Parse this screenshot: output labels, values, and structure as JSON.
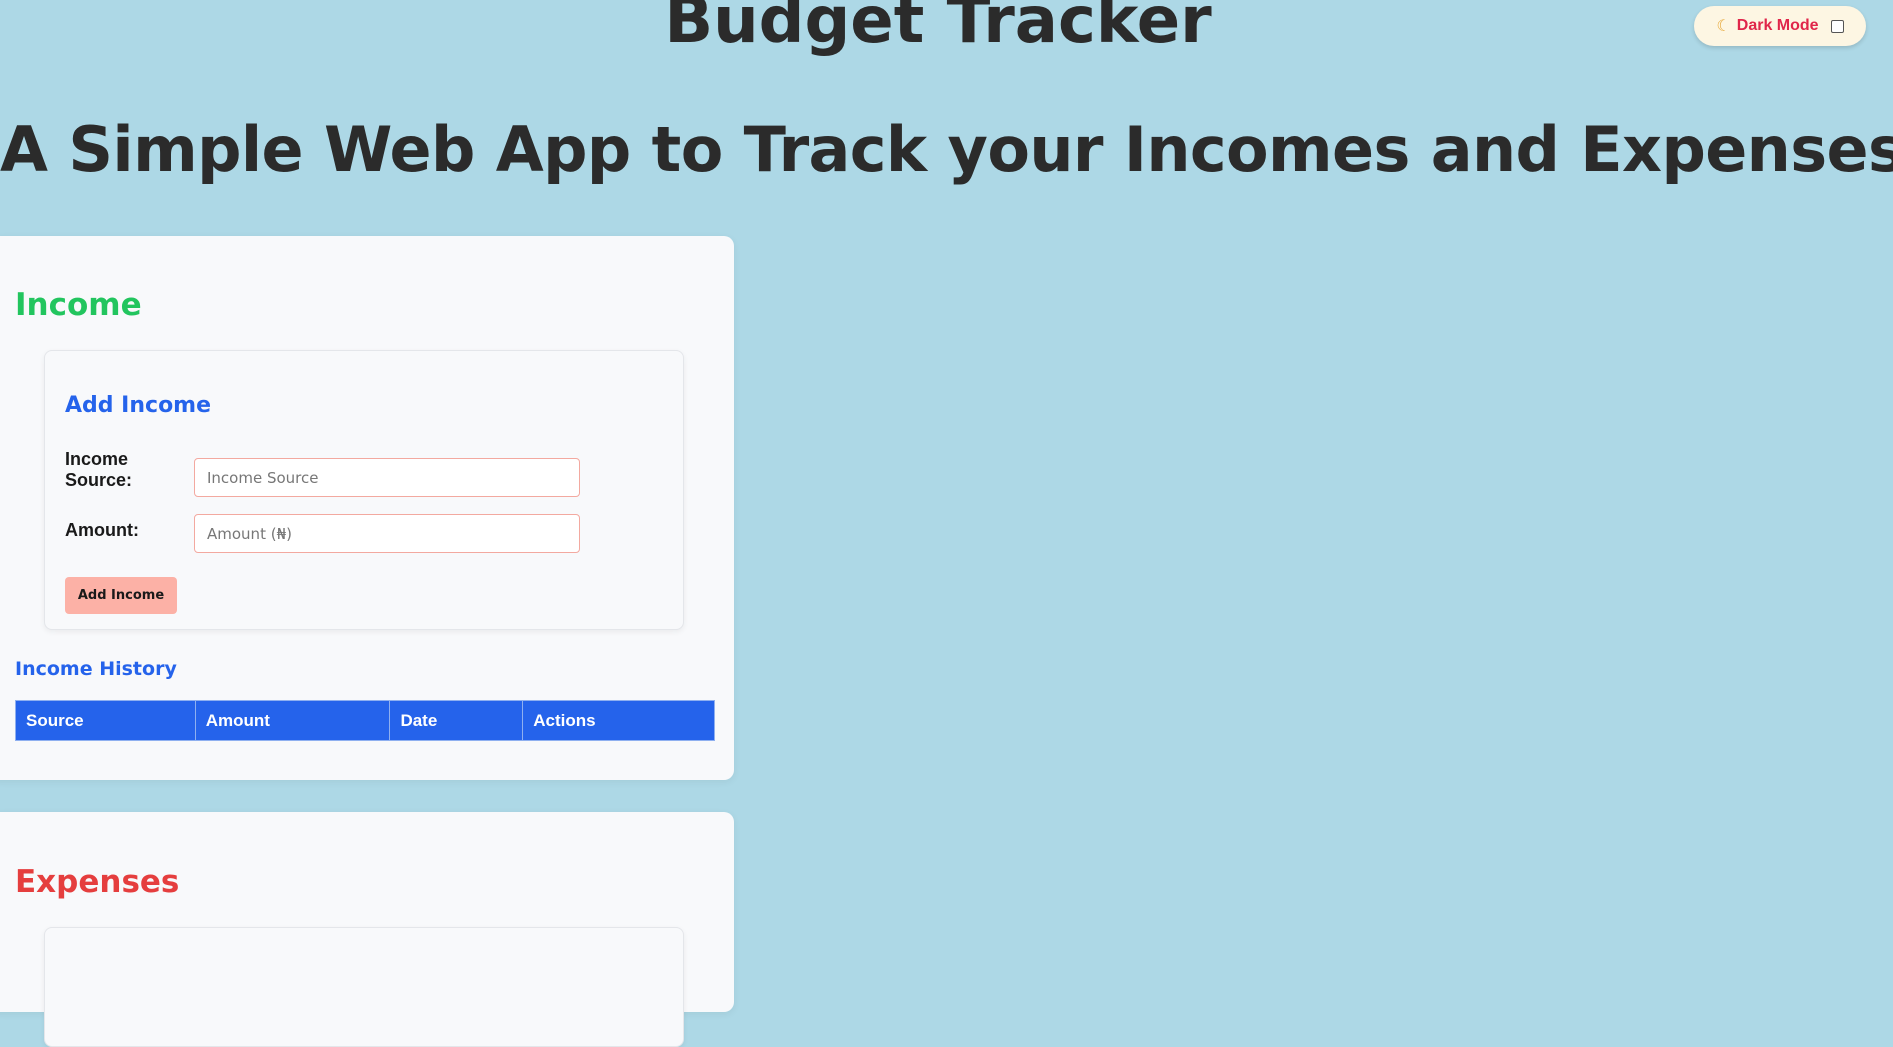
{
  "header": {
    "title": "Budget Tracker",
    "subtitle": "A Simple Web App to Track your Incomes and Expenses."
  },
  "dark_mode": {
    "icon": "moon-icon",
    "label": "Dark Mode",
    "checked": false
  },
  "income": {
    "section_title": "Income",
    "form": {
      "title": "Add Income",
      "source_label": "Income Source:",
      "source_placeholder": "Income Source",
      "source_value": "",
      "amount_label": "Amount:",
      "amount_placeholder": "Amount (₦)",
      "amount_value": "",
      "button_label": "Add Income"
    },
    "history": {
      "title": "Income History",
      "columns": [
        "Source",
        "Amount",
        "Date",
        "Actions"
      ],
      "rows": []
    }
  },
  "expenses": {
    "section_title": "Expenses"
  },
  "colors": {
    "background": "#add8e6",
    "income_accent": "#22c55e",
    "expense_accent": "#e53e3e",
    "primary_blue": "#2563eb",
    "button_bg": "#fcb1a6",
    "toggle_label": "#e0264a"
  }
}
